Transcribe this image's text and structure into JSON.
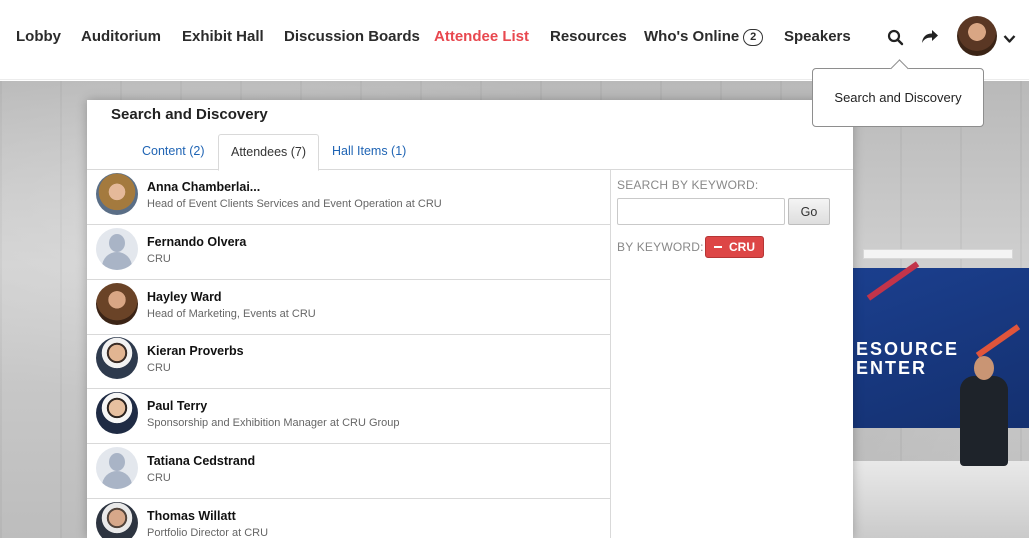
{
  "nav": {
    "items": [
      {
        "label": "Lobby",
        "active": false
      },
      {
        "label": "Auditorium",
        "active": false
      },
      {
        "label": "Exhibit Hall",
        "active": false
      },
      {
        "label": "Discussion Boards",
        "active": false
      },
      {
        "label": "Attendee List",
        "active": true
      },
      {
        "label": "Resources",
        "active": false
      },
      {
        "label": "Who's Online",
        "active": false
      },
      {
        "label": "Speakers",
        "active": false
      }
    ],
    "online_count": "2",
    "icons": [
      "search-icon",
      "share-icon",
      "chevron-down-icon"
    ],
    "active_color": "#e8484f"
  },
  "tooltip": {
    "text": "Search and Discovery"
  },
  "modal": {
    "title": "Search and Discovery",
    "tabs": [
      {
        "label": "Content (2)",
        "active": false
      },
      {
        "label": "Attendees (7)",
        "active": true
      },
      {
        "label": "Hall Items (1)",
        "active": false
      }
    ],
    "attendees": [
      {
        "name": "Anna Chamberlai...",
        "title": "Head of Event Clients Services and Event Operation at CRU",
        "photo": "woman-photo"
      },
      {
        "name": "Fernando Olvera",
        "title": "CRU",
        "photo": "placeholder"
      },
      {
        "name": "Hayley Ward",
        "title": "Head of Marketing, Events at CRU",
        "photo": "woman-photo"
      },
      {
        "name": "Kieran Proverbs",
        "title": "CRU",
        "photo": "man-photo"
      },
      {
        "name": "Paul Terry",
        "title": "Sponsorship and Exhibition Manager at CRU Group",
        "photo": "man-photo"
      },
      {
        "name": "Tatiana Cedstrand",
        "title": "CRU",
        "photo": "placeholder"
      },
      {
        "name": "Thomas Willatt",
        "title": "Portfolio Director at CRU",
        "photo": "man-photo"
      }
    ],
    "sidebar": {
      "search_label": "SEARCH BY KEYWORD:",
      "search_value": "",
      "go_label": "Go",
      "by_keyword_label": "BY KEYWORD:",
      "keyword_chip": "CRU",
      "chip_color": "#dd4646"
    }
  },
  "background": {
    "sign_text_line1": "ESOURCE",
    "sign_text_line2": "ENTER"
  }
}
